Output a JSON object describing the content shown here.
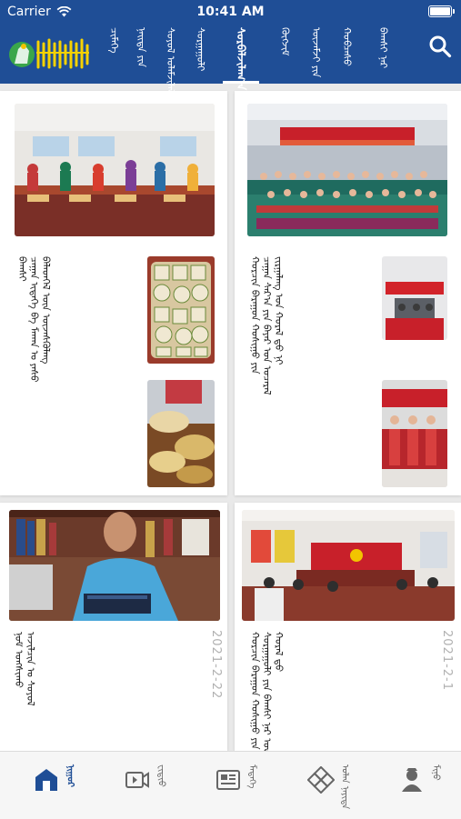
{
  "status": {
    "carrier": "Carrier",
    "time": "10:41 AM"
  },
  "colors": {
    "brand": "#1f4e96",
    "tab_active": "#1f4e96",
    "tab_inactive": "#666666",
    "date": "#b0b0b0"
  },
  "header": {
    "logo_text": "ᠬᠤᠷᠴᠢᠨ",
    "nav_tabs": [
      {
        "label": "ᠴᠢᠮᠡᠭᠡ",
        "active": false
      },
      {
        "label": "ᠨᠡᠢᠲᠡ ᠶᠢᠨ",
        "active": false
      },
      {
        "label": "ᠰᠤᠶᠤᠯ ᠤᠯᠠᠮᠵᠢᠯᠠᠯ",
        "active": false
      },
      {
        "label": "ᠰᠤᠷᠭᠠᠭᠤᠯᠢ",
        "active": false
      },
      {
        "label": "ᠰᠤᠷᠪᠠᠯᠵᠢᠯᠠᠭ᠎ᠠ",
        "active": true
      },
      {
        "label": "ᠬᠥᠭᠵᠢᠮ",
        "active": false
      },
      {
        "label": "ᠦᠵᠡᠮᠵᠢ ᠶᠢᠨ",
        "active": false
      },
      {
        "label": "ᠬᠤᠪᠴᠠᠰᠤ",
        "active": false
      },
      {
        "label": "ᠪᠠᠭᠰᠢ ᠨᠠᠷ",
        "active": false
      }
    ],
    "search_icon": "search-icon"
  },
  "cards": [
    {
      "text_lines": [
        "ᠬᠤᠷᠴᠢᠨ ᠪᠠᠷᠠᠭᠤᠨ ᠬᠣᠰᠢᠭᠤ ᠶᠢᠨ",
        "ᠴᠠᠭᠠᠨ ᠰᠠᠷ᠎ᠠ ᠶᠢᠨ ᠪᠠᠶᠠᠷ ᠤᠨ ᠤᠴᠠᠷᠠᠯ",
        "ᠵᠢᠷᠭᠠᠯᠠᠩ ᠤᠨ ᠬᠤᠷᠠᠯ ᠳ᠋ᠤ ᠨᠢ"
      ],
      "date": ""
    },
    {
      "text_lines": [
        "ᠪᠠᠭᠰᠢ",
        "ᠴᠠᠭᠠᠨ ᠢᠳᠡᠭᠡ ᠪᠠ ᠮᠠᠬᠠᠨ ᠤ ᠶᠠᠰᠤ",
        "ᠪᠡᠯᠡᠳᠬᠡᠯ ᠦᠨ ᠦᠵᠡᠰᠬᠦᠯᠡᠩ"
      ],
      "date": ""
    },
    {
      "text_lines": [
        "ᠬᠤᠷᠴᠢᠨ ᠪᠠᠷᠠᠭᠤᠨ ᠬᠣᠰᠢᠭᠤ ᠶᠢᠨ",
        "ᠰᠤᠷᠭᠠᠭᠤᠯᠢ ᠶᠢᠨ ᠪᠠᠭᠰᠢ ᠨᠠᠷ ᠤᠨ",
        "ᠬᠤᠷᠠᠯ ᠳ᠋ᠤ"
      ],
      "date": "2021-2-1"
    },
    {
      "text_lines": [
        "ᠨᠣᠮ ᠤᠩᠰᠢᠬᠤ",
        "ᠠᠵᠢᠯᠴᠢᠨ ᠤ ᠰᠣᠶᠣᠯ"
      ],
      "date": "2021-2-22"
    }
  ],
  "tabbar": [
    {
      "label": "ᠨᠢᠭᠤᠷ",
      "icon": "home-icon",
      "active": true
    },
    {
      "label": "ᠸᠢᠳᠢᠣ",
      "icon": "video-icon",
      "active": false
    },
    {
      "label": "ᠮᠡᠳᠡᠭᠡ",
      "icon": "news-icon",
      "active": false
    },
    {
      "label": "ᠣᠯᠠᠨ ᠨᠡᠶᠢᠲᠡ",
      "icon": "knot-icon",
      "active": false
    },
    {
      "label": "ᠮᠢᠨᠦ",
      "icon": "profile-icon",
      "active": false
    }
  ]
}
